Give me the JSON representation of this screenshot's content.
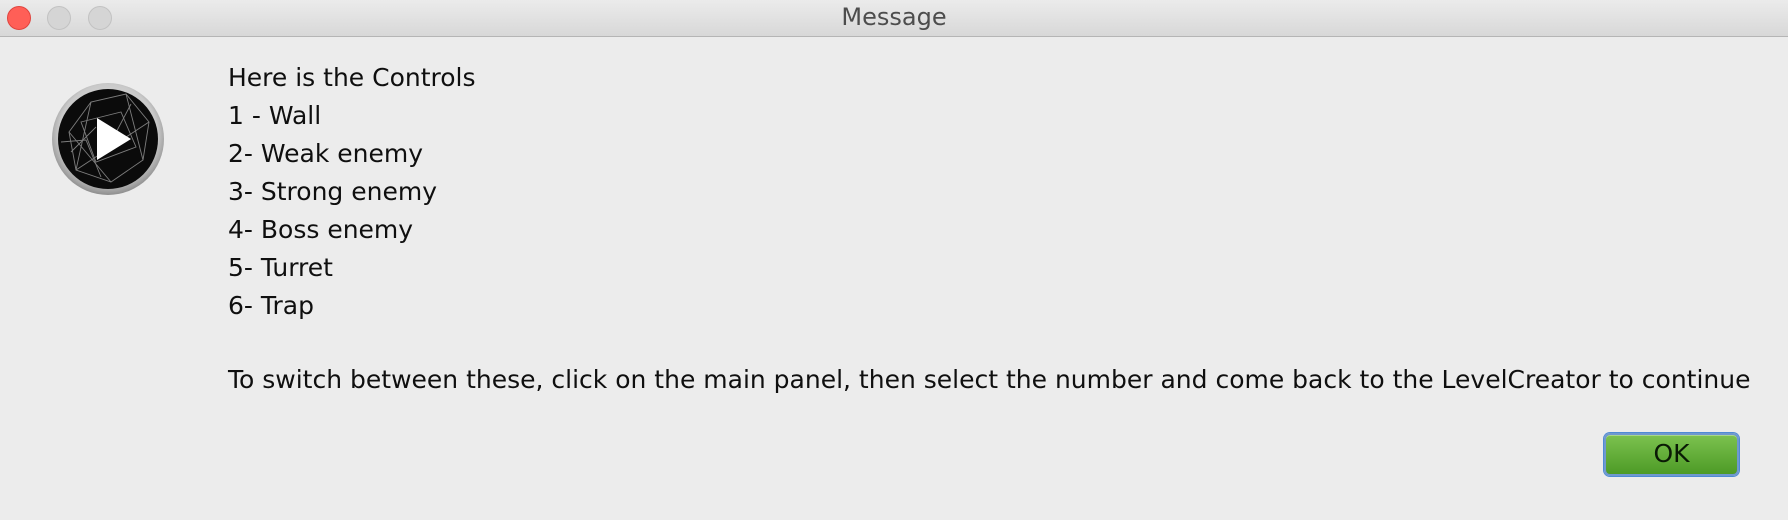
{
  "window": {
    "title": "Message"
  },
  "icon": {
    "name": "play-icon"
  },
  "message": {
    "lines": [
      "Here is the Controls",
      "1 - Wall",
      "2- Weak enemy",
      "3- Strong enemy",
      "4- Boss enemy",
      "5- Turret",
      "6- Trap"
    ],
    "footer": "To switch between these, click on the main panel, then select the number and come back to the LevelCreator to continue"
  },
  "buttons": {
    "ok_label": "OK"
  },
  "colors": {
    "close": "#ff5f57",
    "button_green": "#5fae35",
    "focus_ring": "#4f8bd3"
  }
}
